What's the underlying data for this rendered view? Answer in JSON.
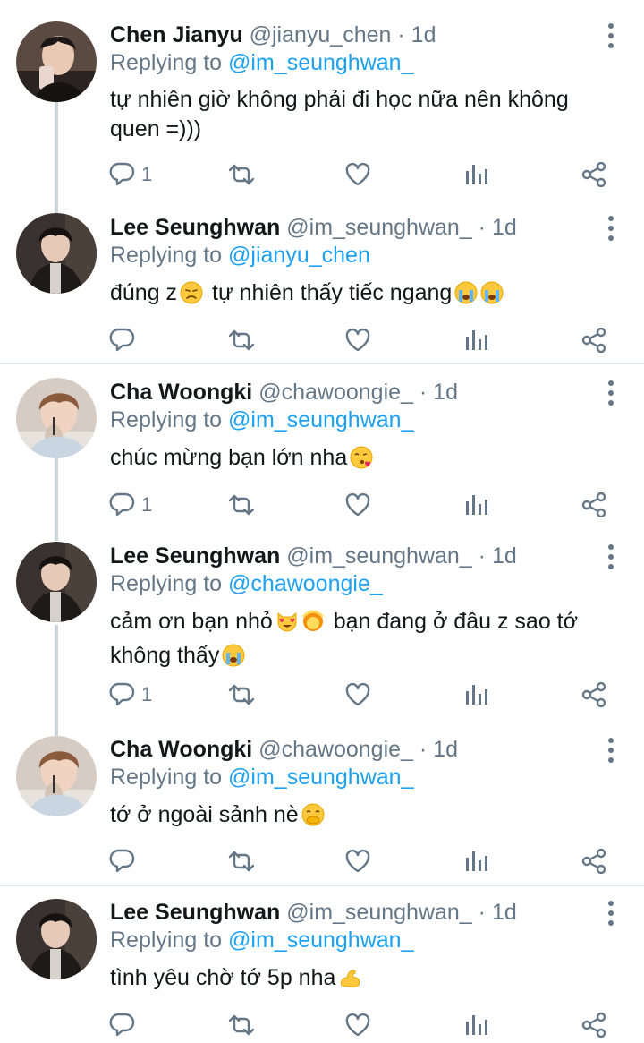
{
  "tweets": [
    {
      "name": "Chen Jianyu",
      "handle": "@jianyu_chen",
      "dot": "·",
      "time": "1d",
      "replying_prefix": "Replying to",
      "replying_to": "@im_seunghwan_",
      "text": "tự nhiên giờ không phải đi học nữa nên không quen =)))",
      "reply_count": "1",
      "avatar": "chen"
    },
    {
      "name": "Lee Seunghwan",
      "handle": "@im_seunghwan_",
      "dot": "·",
      "time": "1d",
      "replying_prefix": "Replying to",
      "replying_to": "@jianyu_chen",
      "text_parts": [
        "đúng z",
        "tự nhiên thấy tiếc ngang"
      ],
      "emojis": [
        "disappointed-face",
        "loudly-crying-face",
        "loudly-crying-face"
      ],
      "reply_count": "",
      "avatar": "lee"
    },
    {
      "name": "Cha Woongki",
      "handle": "@chawoongie_",
      "dot": "·",
      "time": "1d",
      "replying_prefix": "Replying to",
      "replying_to": "@im_seunghwan_",
      "text": "chúc mừng bạn lớn nha",
      "emojis": [
        "face-blowing-kiss"
      ],
      "reply_count": "1",
      "avatar": "cha"
    },
    {
      "name": "Lee Seunghwan",
      "handle": "@im_seunghwan_",
      "dot": "·",
      "time": "1d",
      "replying_prefix": "Replying to",
      "replying_to": "@chawoongie_",
      "text_parts": [
        "cảm ơn bạn nhỏ",
        "bạn đang ở đâu z sao tớ",
        "không thấy"
      ],
      "emojis": [
        "smiling-cat-heart-eyes",
        "person-gesturing-ok",
        "loudly-crying-face"
      ],
      "reply_count": "1",
      "avatar": "lee"
    },
    {
      "name": "Cha Woongki",
      "handle": "@chawoongie_",
      "dot": "·",
      "time": "1d",
      "replying_prefix": "Replying to",
      "replying_to": "@im_seunghwan_",
      "text": "tớ ở ngoài sảnh nè",
      "emojis": [
        "face-with-hand-over-mouth"
      ],
      "reply_count": "",
      "avatar": "cha"
    },
    {
      "name": "Lee Seunghwan",
      "handle": "@im_seunghwan_",
      "dot": "·",
      "time": "1d",
      "replying_prefix": "Replying to",
      "replying_to": "@im_seunghwan_",
      "text": "tình yêu chờ tớ 5p nha",
      "emojis": [
        "flexed-biceps"
      ],
      "reply_count": "",
      "avatar": "lee"
    }
  ],
  "icons": {
    "reply": "reply-icon",
    "retweet": "retweet-icon",
    "like": "like-icon",
    "analytics": "analytics-icon",
    "share": "share-icon",
    "more": "more-options-icon"
  },
  "colors": {
    "icon": "#657786",
    "mention": "#1da1f2",
    "thread_line": "#ccd6dd"
  }
}
